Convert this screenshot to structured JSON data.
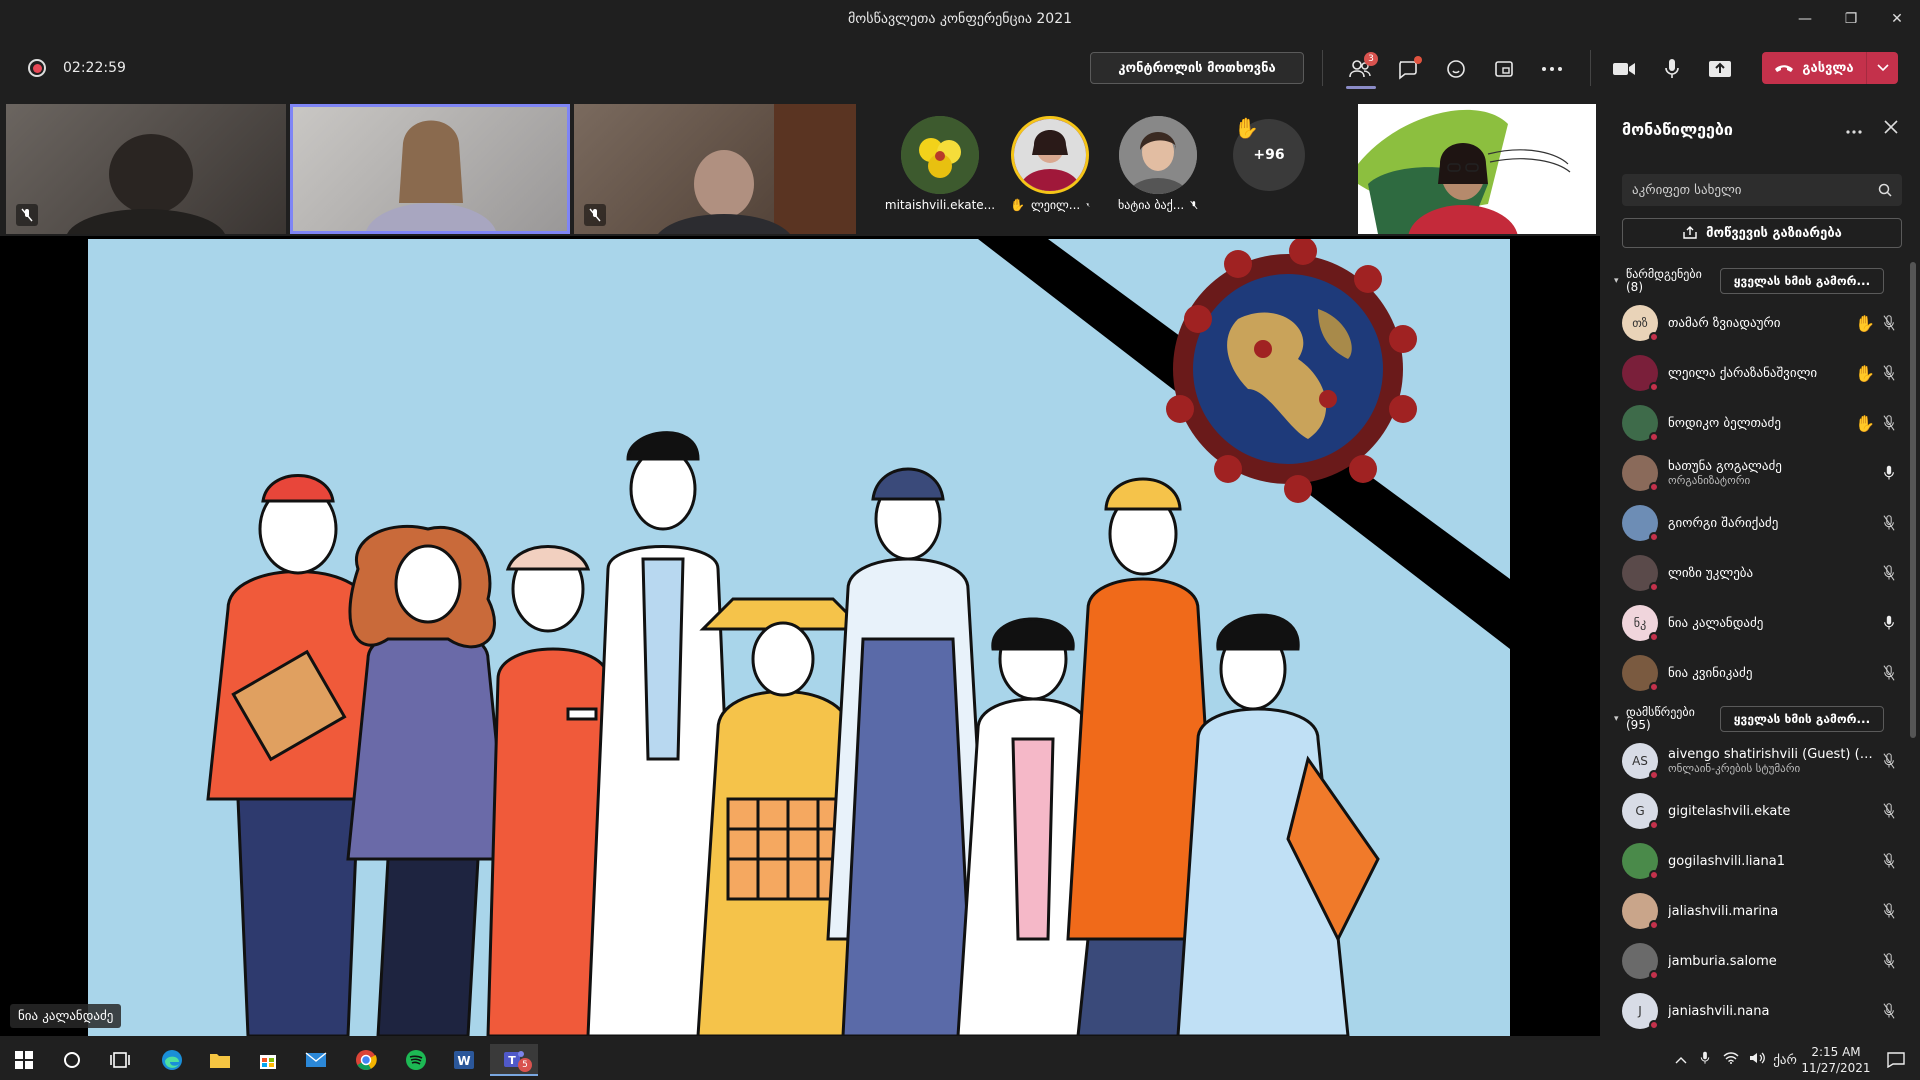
{
  "window": {
    "title": "მოსწავლეთა კონფერენცია 2021",
    "minimize": "—",
    "restore": "❐",
    "close": "✕"
  },
  "toolbar": {
    "recording_time": "02:22:59",
    "request_control": "კონტროლის მოთხოვნა",
    "participants_badge": "3",
    "leave_label": "გასვლა"
  },
  "video_tiles": [
    {
      "name": "",
      "muted": true
    },
    {
      "name": "",
      "muted": false,
      "active": true
    },
    {
      "name": "",
      "muted": true
    }
  ],
  "avatar_tiles": [
    {
      "name": "mitaishvili.ekate..."
    },
    {
      "name": "ლეილ...",
      "hand": "✋"
    },
    {
      "name": "ხატია ბაქ..."
    }
  ],
  "overflow_count": "+96",
  "presenter_label": "ნია კალანდაძე",
  "panel": {
    "title": "მონაწილეები",
    "search_placeholder": "აკრიფეთ სახელი",
    "share_invite": "მოწვევის გაზიარება",
    "presenters_section": {
      "label": "წარმდგენები (8)",
      "mute_all": "ყველას ხმის გამორ..."
    },
    "attendees_section": {
      "label": "დამსწრეები (95)",
      "mute_all": "ყველას ხმის გამორ..."
    },
    "presenters": [
      {
        "name": "თამარ ზვიადაური",
        "sub": "",
        "initials": "თზ",
        "hand": "✋",
        "mic": "off",
        "color": "#e9d3b8"
      },
      {
        "name": "ლეილა ქარაზანაშვილი",
        "sub": "",
        "initials": "",
        "hand": "✋",
        "mic": "off",
        "color": "#7a1f3a"
      },
      {
        "name": "ნოდიკო ბელთაძე",
        "sub": "",
        "initials": "",
        "hand": "✋",
        "mic": "off",
        "color": "#3e6b4a"
      },
      {
        "name": "ხათუნა გოგალაძე",
        "sub": "ორგანიზატორი",
        "initials": "",
        "hand": "",
        "mic": "on",
        "color": "#8a6a5a"
      },
      {
        "name": "გიორგი შარიქაძე",
        "sub": "",
        "initials": "",
        "hand": "",
        "mic": "off",
        "color": "#6d8db5"
      },
      {
        "name": "ლიზი უკლება",
        "sub": "",
        "initials": "",
        "hand": "",
        "mic": "off",
        "color": "#5a4a4a"
      },
      {
        "name": "ნია კალანდაძე",
        "sub": "",
        "initials": "ნკ",
        "hand": "",
        "mic": "on",
        "color": "#f0d5dc"
      },
      {
        "name": "ნია კვინიკაძე",
        "sub": "",
        "initials": "",
        "hand": "",
        "mic": "off",
        "color": "#7a5a40"
      }
    ],
    "attendees": [
      {
        "name": "aivengo shatirishvili (Guest) (U...",
        "sub": "ონლაინ-კრების სტუმარი",
        "initials": "AS",
        "mic": "off",
        "color": "#d8dce6"
      },
      {
        "name": "gigitelashvili.ekate",
        "sub": "",
        "initials": "G",
        "mic": "off",
        "color": "#d8dce6"
      },
      {
        "name": "gogilashvili.liana1",
        "sub": "",
        "initials": "",
        "mic": "off",
        "color": "#4a8a4a"
      },
      {
        "name": "jaliashvili.marina",
        "sub": "",
        "initials": "",
        "mic": "off",
        "color": "#c9a58a"
      },
      {
        "name": "jamburia.salome",
        "sub": "",
        "initials": "",
        "mic": "off",
        "color": "#6a6a6a"
      },
      {
        "name": "janiashvili.nana",
        "sub": "",
        "initials": "J",
        "mic": "off",
        "color": "#d8dce6"
      }
    ]
  },
  "taskbar": {
    "language": "ქარ",
    "time": "2:15 AM",
    "date": "11/27/2021",
    "teams_badge": "5"
  }
}
